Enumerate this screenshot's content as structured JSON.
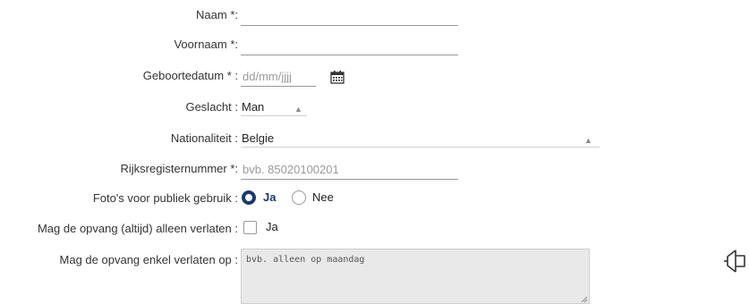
{
  "form": {
    "naam": {
      "label": "Naam *:",
      "value": "",
      "placeholder": ""
    },
    "voornaam": {
      "label": "Voornaam *:",
      "value": "",
      "placeholder": ""
    },
    "geboortedatum": {
      "label": "Geboortedatum * :",
      "placeholder": "dd/mm/jjjj",
      "icon": "calendar-icon"
    },
    "geslacht": {
      "label": "Geslacht :",
      "selected": "Man"
    },
    "nationaliteit": {
      "label": "Nationaliteit :",
      "selected": "Belgie"
    },
    "rijksregisternummer": {
      "label": "Rijksregisternummer *:",
      "placeholder": "bvb. 85020100201"
    },
    "fotos": {
      "label": "Foto's voor publiek gebruik :",
      "options": [
        "Ja",
        "Nee"
      ],
      "selected": "Ja"
    },
    "alleen_verlaten": {
      "label": "Mag de opvang (altijd) alleen verlaten :",
      "checkbox_label": "Ja",
      "checked": false
    },
    "enkel_verlaten": {
      "label": "Mag de opvang enkel verlaten op :",
      "placeholder": "bvb. alleen op maandag"
    }
  },
  "colors": {
    "accent": "#1a3a6b",
    "border": "#999999",
    "textarea_bg": "#e9e9e9"
  }
}
